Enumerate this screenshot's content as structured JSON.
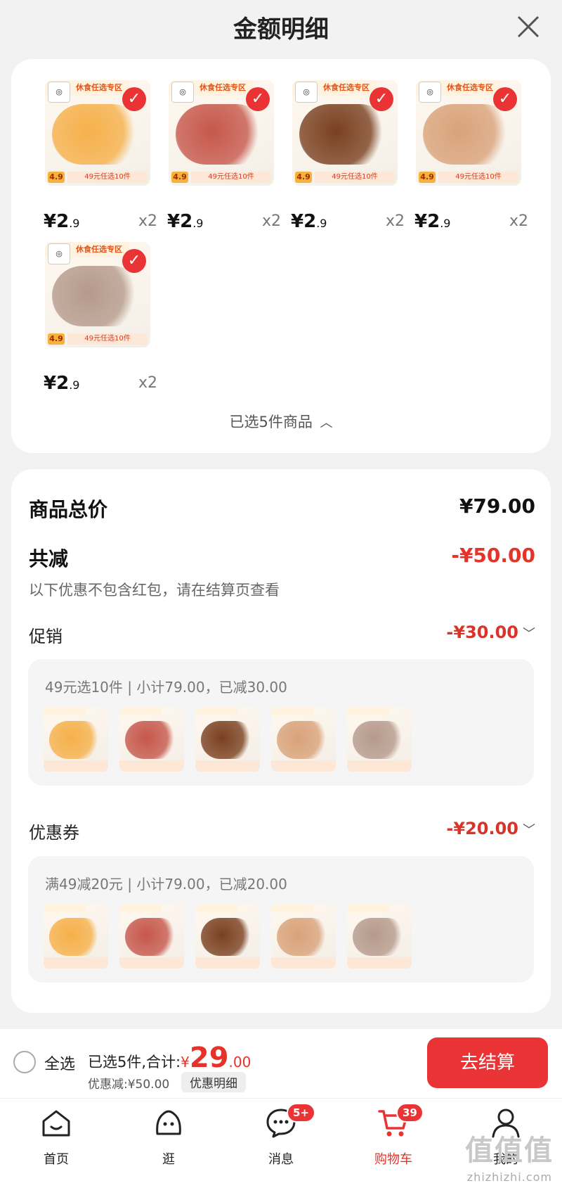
{
  "header": {
    "title": "金额明细"
  },
  "items": [
    {
      "price_main": "¥2",
      "price_dec": ".9",
      "qty": "x2",
      "tag": "休食任选专区",
      "promo": "49元任选10件",
      "badge": "4.9",
      "color": "#f6b04a"
    },
    {
      "price_main": "¥2",
      "price_dec": ".9",
      "qty": "x2",
      "tag": "休食任选专区",
      "promo": "49元任选10件",
      "badge": "4.9",
      "color": "#c6574b"
    },
    {
      "price_main": "¥2",
      "price_dec": ".9",
      "qty": "x2",
      "tag": "休食任选专区",
      "promo": "49元任选10件",
      "badge": "4.9",
      "color": "#7a4020"
    },
    {
      "price_main": "¥2",
      "price_dec": ".9",
      "qty": "x2",
      "tag": "休食任选专区",
      "promo": "49元任选10件",
      "badge": "4.9",
      "color": "#d9a27a"
    },
    {
      "price_main": "¥2",
      "price_dec": ".9",
      "qty": "x2",
      "tag": "休食任选专区",
      "promo": "49元任选10件",
      "badge": "4.9",
      "color": "#b59a8c"
    }
  ],
  "selected_toggle": "已选5件商品",
  "summary": {
    "total_label": "商品总价",
    "total_value": "¥79.00",
    "reduce_label": "共减",
    "reduce_value": "-¥50.00",
    "note": "以下优惠不包含红包，请在结算页查看",
    "promo_label": "促销",
    "promo_value": "-¥30.00",
    "promo_desc": "49元选10件 | 小计79.00，已减30.00",
    "coupon_label": "优惠券",
    "coupon_value": "-¥20.00",
    "coupon_desc": "满49减20元 | 小计79.00，已减20.00"
  },
  "bottom": {
    "select_all": "全选",
    "selected_text": "已选5件,合计:",
    "currency": "¥",
    "amount_int": "29",
    "amount_dec": ".00",
    "discount_text": "优惠减:¥50.00",
    "detail_button": "优惠明细",
    "checkout": "去结算"
  },
  "tabs": [
    {
      "label": "首页",
      "icon": "home-icon"
    },
    {
      "label": "逛",
      "icon": "stroll-icon"
    },
    {
      "label": "消息",
      "icon": "message-icon",
      "badge": "5+"
    },
    {
      "label": "购物车",
      "icon": "cart-icon",
      "badge": "39",
      "active": true
    },
    {
      "label": "我的",
      "icon": "profile-icon"
    }
  ],
  "watermark": "zhizhizhi.com",
  "watermark_logo": "值值值",
  "colors": {
    "accent": "#ea3334"
  }
}
